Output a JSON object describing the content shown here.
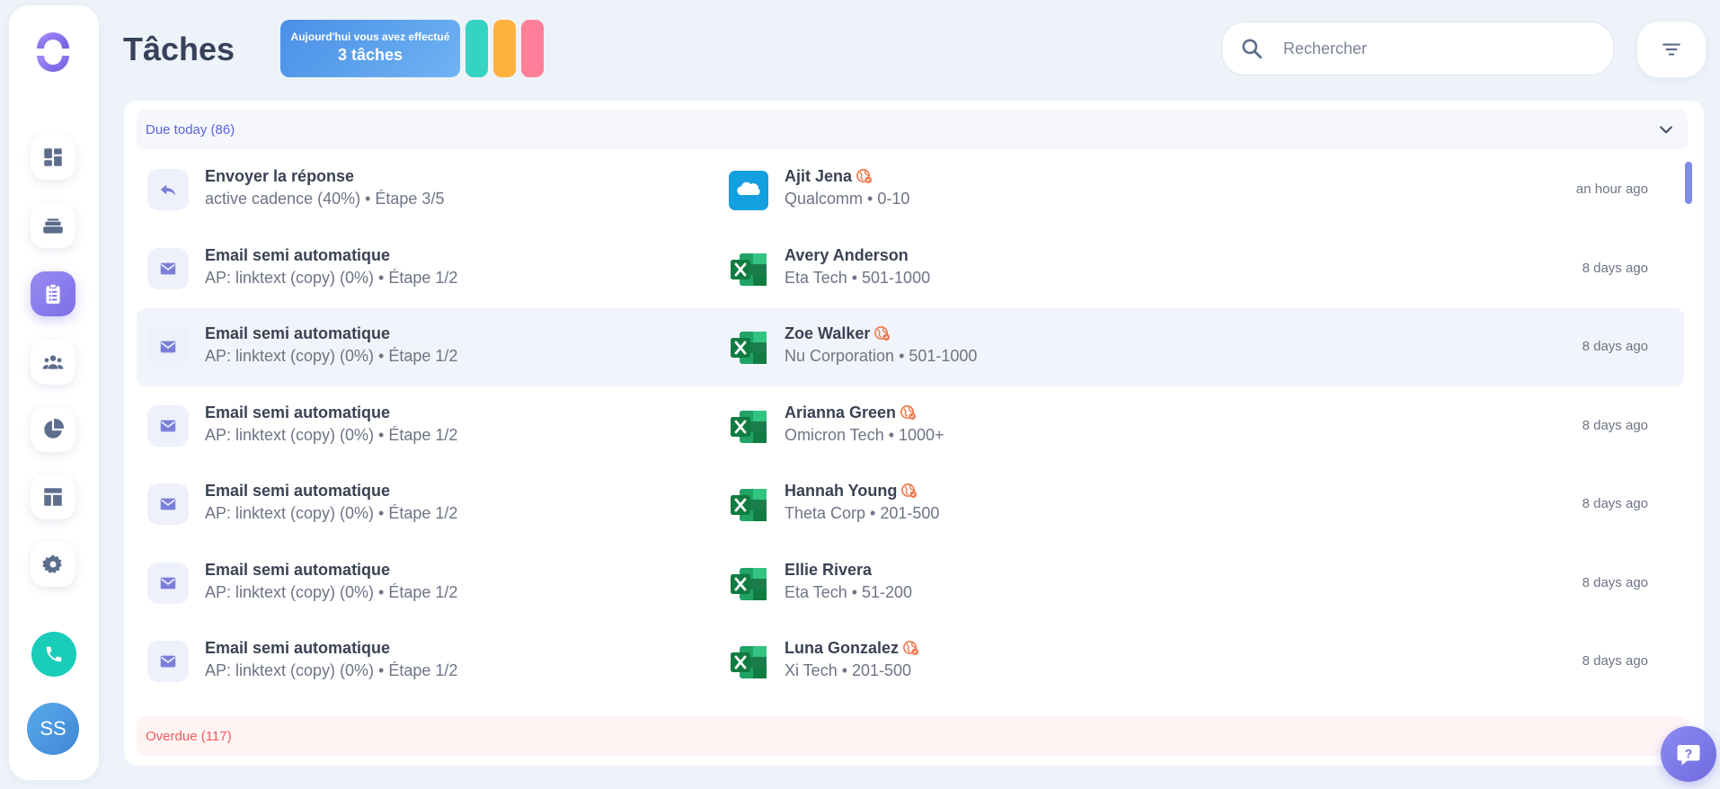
{
  "app": {
    "title": "Tâches",
    "user_initials": "SS"
  },
  "colors": {
    "accent": "#7b6ee6",
    "teal": "#35d3c3",
    "orange": "#ffb23e",
    "pink": "#ff7e98",
    "today": "#5a63d8",
    "overdue": "#ef5b5b"
  },
  "sidebar": {
    "items": [
      {
        "name": "dashboard",
        "icon": "dashboard-icon"
      },
      {
        "name": "inbox",
        "icon": "inbox-icon"
      },
      {
        "name": "tasks",
        "icon": "clipboard-icon",
        "active": true
      },
      {
        "name": "contacts",
        "icon": "people-icon"
      },
      {
        "name": "reports",
        "icon": "pie-chart-icon"
      },
      {
        "name": "templates",
        "icon": "layout-icon"
      },
      {
        "name": "settings",
        "icon": "gear-icon"
      }
    ],
    "phone_icon": "phone-icon"
  },
  "summary": {
    "line1": "Aujourd'hui vous avez effectué",
    "line2": "3 tâches"
  },
  "search": {
    "placeholder": "Rechercher",
    "value": ""
  },
  "sections": {
    "today": {
      "label": "Due today (86)"
    },
    "overdue": {
      "label": "Overdue (117)"
    }
  },
  "tasks": [
    {
      "type": "reply",
      "icon": "reply-icon",
      "title": "Envoyer la réponse",
      "subtitle": "active cadence (40%) • Étape 3/5",
      "source": "salesforce",
      "name": "Ajit Jena",
      "company": "Qualcomm • 0-10",
      "globe": true,
      "time": "an hour ago"
    },
    {
      "type": "email",
      "icon": "mail-icon",
      "title": "Email semi automatique",
      "subtitle": "AP: linktext (copy) (0%) • Étape 1/2",
      "source": "excel",
      "name": "Avery Anderson",
      "company": "Eta Tech • 501-1000",
      "globe": false,
      "time": "8 days ago"
    },
    {
      "type": "email",
      "icon": "mail-icon",
      "title": "Email semi automatique",
      "subtitle": "AP: linktext (copy) (0%) • Étape 1/2",
      "source": "excel",
      "name": "Zoe Walker",
      "company": "Nu Corporation • 501-1000",
      "globe": true,
      "time": "8 days ago",
      "highlight": true
    },
    {
      "type": "email",
      "icon": "mail-icon",
      "title": "Email semi automatique",
      "subtitle": "AP: linktext (copy) (0%) • Étape 1/2",
      "source": "excel",
      "name": "Arianna Green",
      "company": "Omicron Tech • 1000+",
      "globe": true,
      "time": "8 days ago"
    },
    {
      "type": "email",
      "icon": "mail-icon",
      "title": "Email semi automatique",
      "subtitle": "AP: linktext (copy) (0%) • Étape 1/2",
      "source": "excel",
      "name": "Hannah Young",
      "company": "Theta Corp • 201-500",
      "globe": true,
      "time": "8 days ago"
    },
    {
      "type": "email",
      "icon": "mail-icon",
      "title": "Email semi automatique",
      "subtitle": "AP: linktext (copy) (0%) • Étape 1/2",
      "source": "excel",
      "name": "Ellie Rivera",
      "company": "Eta Tech • 51-200",
      "globe": false,
      "time": "8 days ago"
    },
    {
      "type": "email",
      "icon": "mail-icon",
      "title": "Email semi automatique",
      "subtitle": "AP: linktext (copy) (0%) • Étape 1/2",
      "source": "excel",
      "name": "Luna Gonzalez",
      "company": "Xi Tech • 201-500",
      "globe": true,
      "time": "8 days ago"
    }
  ]
}
